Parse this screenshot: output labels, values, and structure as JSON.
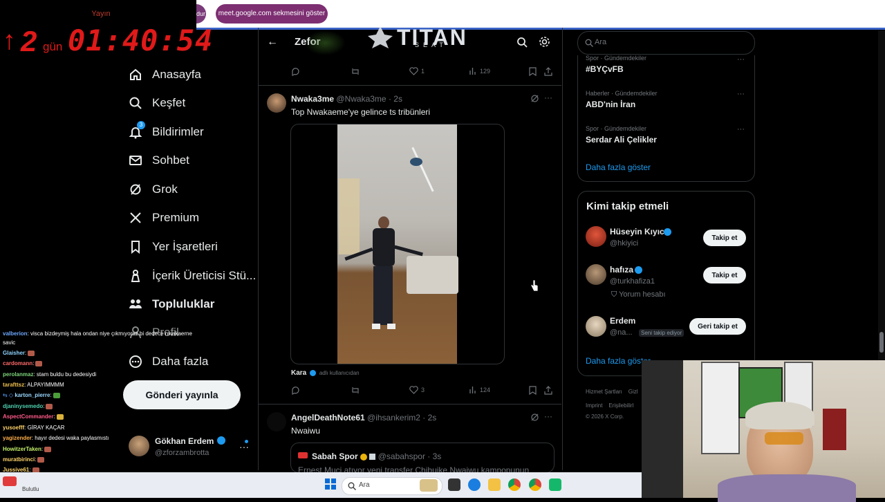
{
  "browser": {
    "pill_left_label": "dur",
    "meet_pill_label": "meet.google.com sekmesini göster"
  },
  "timer": {
    "label": "Yayın",
    "arrow": "↑",
    "days": "2",
    "days_unit": "gün",
    "time": "01:40:54"
  },
  "logo": {
    "text": "TITAN",
    "sub": "SEAT"
  },
  "nav": {
    "items": [
      {
        "label": "Anasayfa",
        "icon": "home-icon"
      },
      {
        "label": "Keşfet",
        "icon": "search-icon"
      },
      {
        "label": "Bildirimler",
        "icon": "bell-icon",
        "badge": "3"
      },
      {
        "label": "Sohbet",
        "icon": "mail-icon"
      },
      {
        "label": "Grok",
        "icon": "grok-icon"
      },
      {
        "label": "Premium",
        "icon": "x-icon"
      },
      {
        "label": "Yer İşaretleri",
        "icon": "bookmark-icon"
      },
      {
        "label": "İçerik Üreticisi Stü...",
        "icon": "creator-icon"
      },
      {
        "label": "Topluluklar",
        "icon": "communities-icon"
      },
      {
        "label": "Profil",
        "icon": "profile-icon"
      },
      {
        "label": "Daha fazla",
        "icon": "more-icon"
      }
    ],
    "post_button": "Gönderi yayınla",
    "profile": {
      "name": "Gökhan Erdem",
      "handle": "@zforzambrotta"
    }
  },
  "chat": [
    {
      "user": "valberion",
      "text": ": visca bizdeymiş hala ondan niye çıkmıyoruz bi dedece nwakaerne"
    },
    {
      "user": "",
      "text": "savic"
    },
    {
      "user": "Glaisher",
      "text": ":"
    },
    {
      "user": "cardomann",
      "text": ":"
    },
    {
      "user": "perolanmaz",
      "text": ": stam buldu bu dedesiydi"
    },
    {
      "user": "tarafttsz",
      "text": ": ALPAYIMMMM"
    },
    {
      "user": "karton_pierre",
      "text": ":"
    },
    {
      "user": "djaninysemedo",
      "text": ":"
    },
    {
      "user": "AspectCommander",
      "text": ":"
    },
    {
      "user": "yusoefff",
      "text": ": GİRAY KAÇAR"
    },
    {
      "user": "yagizender",
      "text": ": hayır dedesi waka paylasmıstı"
    },
    {
      "user": "HowitzerTaken",
      "text": ":"
    },
    {
      "user": "muratbirinci",
      "text": ":"
    },
    {
      "user": "Jussive61",
      "text": ":"
    }
  ],
  "center": {
    "header_back": "←",
    "header_title": "Zefor",
    "prev_tweet_actions": {
      "likes": "1",
      "views": "129"
    },
    "tweet1": {
      "author": "Nwaka3me",
      "handle": "@Nwaka3me",
      "time": "2s",
      "text": "Top Nwakaeme'ye gelince ts tribünleri",
      "caption_name": "Kara",
      "caption_sub": "adlı kullanıcıdan",
      "likes": "3",
      "views": "124"
    },
    "tweet2": {
      "author": "AngelDeathNote61",
      "handle": "@ihsankerim2",
      "time": "2s",
      "text": "Nwaiwu",
      "quote_author": "Sabah Spor",
      "quote_handle": "@sabahspor",
      "quote_time": "3s",
      "quote_text": "Ernest Muçi atıyor yeni transfer Chibuike Nwaiwu kampopunun"
    }
  },
  "right": {
    "search_placeholder": "Ara",
    "trends": [
      {
        "category": "Spor · Gündemdekiler",
        "title": "#BYÇvFB"
      },
      {
        "category": "Haberler · Gündemdekiler",
        "title": "ABD'nin İran"
      },
      {
        "category": "Spor · Gündemdekiler",
        "title": "Serdar Ali Çelikler"
      }
    ],
    "show_more": "Daha fazla göster",
    "who_to_follow_title": "Kimi takip etmeli",
    "follows": [
      {
        "name": "Hüseyin Kıyıcı",
        "handle": "@hkiyici",
        "button": "Takip et",
        "extra": ""
      },
      {
        "name": "hafıza",
        "handle": "@turkhafiza1",
        "button": "Takip et",
        "extra": "Yorum hesabı"
      },
      {
        "name": "Erdem",
        "handle": "@na...",
        "button": "Geri takip et",
        "extra": "Seni takip ediyor"
      }
    ],
    "show_more2": "Daha fazla göster",
    "footer1": "Hizmet Şartları",
    "footer1b": "Gizl",
    "footer2": "Imprint",
    "footer2b": "Erişilebilirl",
    "footer3": "© 2026 X Corp."
  },
  "taskbar": {
    "left_label": "Bulutlu",
    "search_placeholder": "Ara"
  }
}
